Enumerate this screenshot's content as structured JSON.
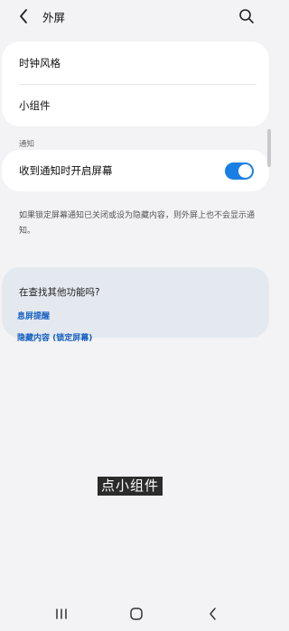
{
  "header": {
    "title": "外屏"
  },
  "card1": {
    "items": [
      {
        "label": "时钟风格"
      },
      {
        "label": "小组件"
      }
    ]
  },
  "section": {
    "label": "通知"
  },
  "notification_toggle": {
    "label": "收到通知时开启屏幕",
    "state": "on",
    "accent_color": "#1a7fe5"
  },
  "note": {
    "text": "如果锁定屏幕通知已关闭或设为隐藏内容，则外屏上也不会显示通知。"
  },
  "suggestions": {
    "title": "在查找其他功能吗?",
    "links": [
      {
        "label": "息屏提醒"
      },
      {
        "label": "隐藏内容 (锁定屏幕)"
      }
    ]
  },
  "subtitle": {
    "text": "点小组件"
  },
  "navbar": {
    "icons": [
      "recent-apps-icon",
      "home-icon",
      "back-icon"
    ]
  }
}
